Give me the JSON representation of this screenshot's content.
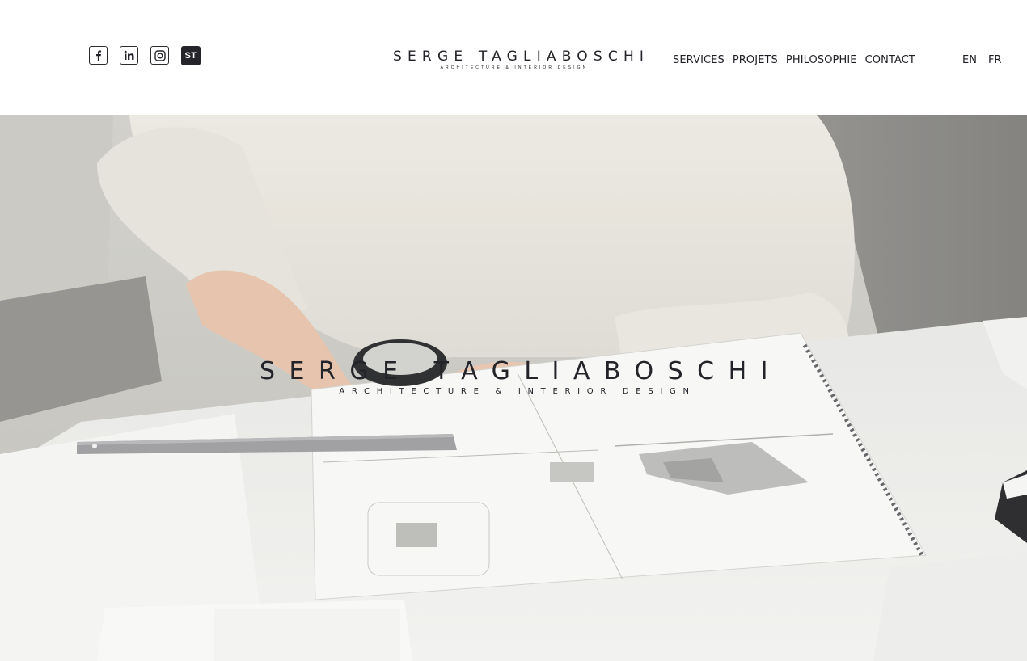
{
  "brand": {
    "name": "SERGE TAGLIABOSCHI",
    "tagline": "ARCHITECTURE & INTERIOR DESIGN"
  },
  "socials": [
    {
      "name": "facebook",
      "icon": "facebook-icon"
    },
    {
      "name": "linkedin",
      "icon": "linkedin-icon"
    },
    {
      "name": "instagram",
      "icon": "instagram-icon"
    },
    {
      "name": "st",
      "icon": "st-monogram-icon",
      "label": "ST"
    }
  ],
  "nav": {
    "services": "SERVICES",
    "projets": "PROJETS",
    "philosophie": "PHILOSOPHIE",
    "contact": "CONTACT"
  },
  "lang": {
    "en": "EN",
    "fr": "FR"
  },
  "hero": {
    "title": "SERGE TAGLIABOSCHI",
    "subtitle": "ARCHITECTURE & INTERIOR DESIGN"
  },
  "colors": {
    "text": "#1e1e24",
    "background": "#ffffff",
    "hero_tone": "#d9d8d2"
  }
}
